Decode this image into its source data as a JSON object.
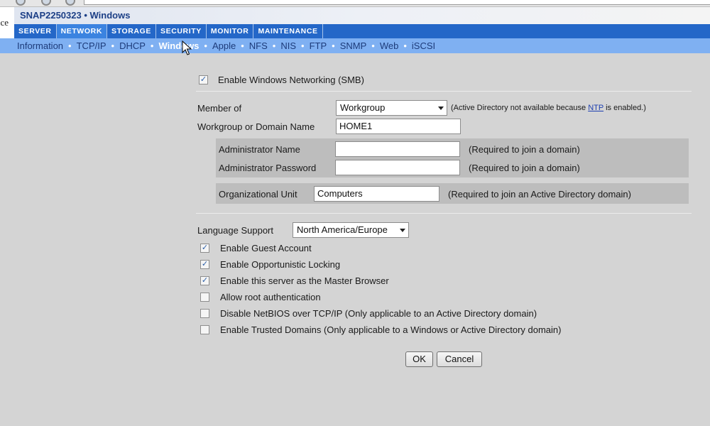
{
  "window": {
    "left_clip_text": "nce",
    "title": "SNAP2250323 • Windows"
  },
  "main_nav": {
    "tabs": [
      {
        "label": "SERVER",
        "active": false
      },
      {
        "label": "NETWORK",
        "active": true
      },
      {
        "label": "STORAGE",
        "active": false
      },
      {
        "label": "SECURITY",
        "active": false
      },
      {
        "label": "MONITOR",
        "active": false
      },
      {
        "label": "MAINTENANCE",
        "active": false
      }
    ]
  },
  "sub_nav": {
    "separator": "•",
    "items": [
      {
        "label": "Information",
        "active": false
      },
      {
        "label": "TCP/IP",
        "active": false
      },
      {
        "label": "DHCP",
        "active": false
      },
      {
        "label": "Windows",
        "active": true
      },
      {
        "label": "Apple",
        "active": false
      },
      {
        "label": "NFS",
        "active": false
      },
      {
        "label": "NIS",
        "active": false
      },
      {
        "label": "FTP",
        "active": false
      },
      {
        "label": "SNMP",
        "active": false
      },
      {
        "label": "Web",
        "active": false
      },
      {
        "label": "iSCSI",
        "active": false
      }
    ]
  },
  "form": {
    "enable_smb": {
      "label": "Enable Windows Networking (SMB)",
      "checked": true
    },
    "member_of": {
      "label": "Member of",
      "value": "Workgroup",
      "note_prefix": "(Active Directory not available because ",
      "note_link": "NTP",
      "note_suffix": " is enabled.)"
    },
    "workgroup": {
      "label": "Workgroup or Domain Name",
      "value": "HOME1"
    },
    "admin_name": {
      "label": "Administrator Name",
      "value": "",
      "note": "(Required to join a domain)"
    },
    "admin_password": {
      "label": "Administrator Password",
      "value": "",
      "note": "(Required to join a domain)"
    },
    "org_unit": {
      "label": "Organizational Unit",
      "value": "Computers",
      "note": "(Required to join an Active Directory domain)"
    },
    "language": {
      "label": "Language Support",
      "value": "North America/Europe"
    },
    "options": [
      {
        "label": "Enable Guest Account",
        "checked": true
      },
      {
        "label": "Enable Opportunistic Locking",
        "checked": true
      },
      {
        "label": "Enable this server as the Master Browser",
        "checked": true
      },
      {
        "label": "Allow root authentication",
        "checked": false
      },
      {
        "label": "Disable NetBIOS over TCP/IP (Only applicable to an Active Directory domain)",
        "checked": false
      },
      {
        "label": "Enable Trusted Domains (Only applicable to a Windows or Active Directory domain)",
        "checked": false
      }
    ]
  },
  "buttons": {
    "ok": "OK",
    "cancel": "Cancel"
  },
  "check_glyph": "✓"
}
